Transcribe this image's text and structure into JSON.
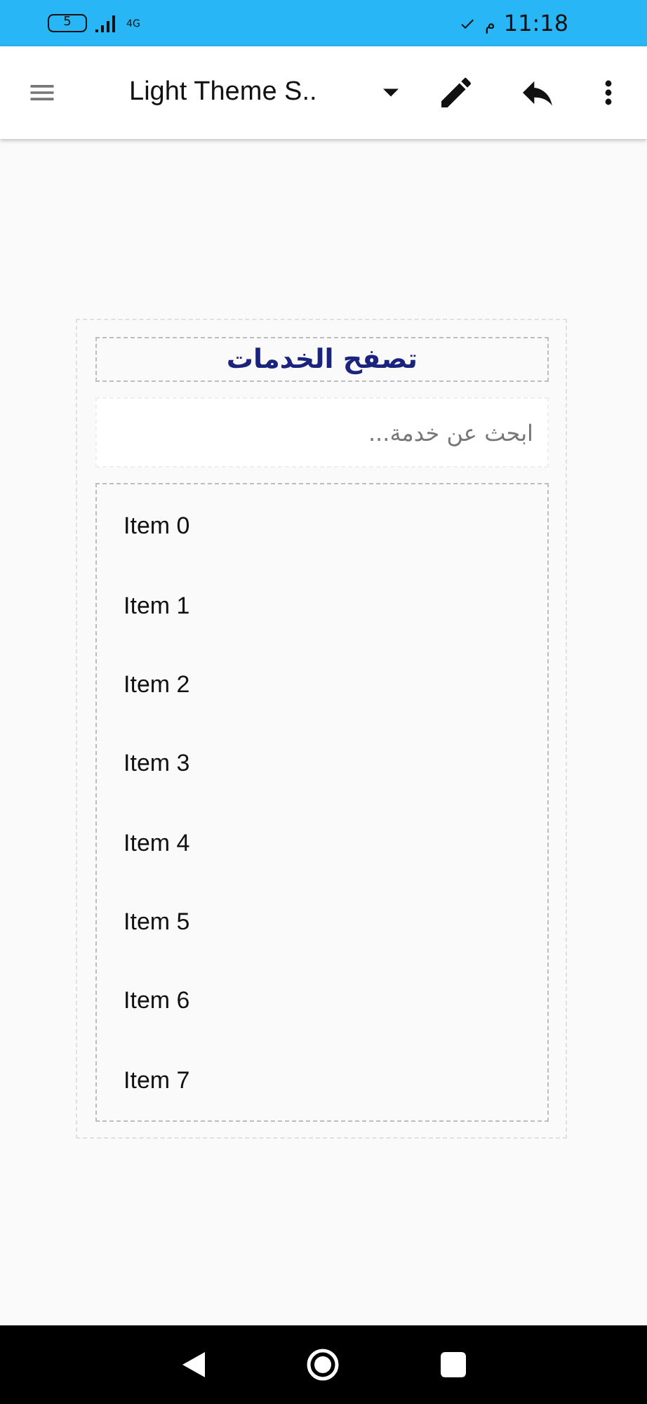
{
  "status_bar": {
    "battery": "5",
    "network": "4G",
    "ampm": "م",
    "time": "11:18"
  },
  "app_bar": {
    "title": "Light Theme S.."
  },
  "panel": {
    "title": "تصفح الخدمات",
    "search": {
      "placeholder": "ابحث عن خدمة..."
    },
    "items": [
      "Item 0",
      "Item 1",
      "Item 2",
      "Item 3",
      "Item 4",
      "Item 5",
      "Item 6",
      "Item 7"
    ]
  }
}
